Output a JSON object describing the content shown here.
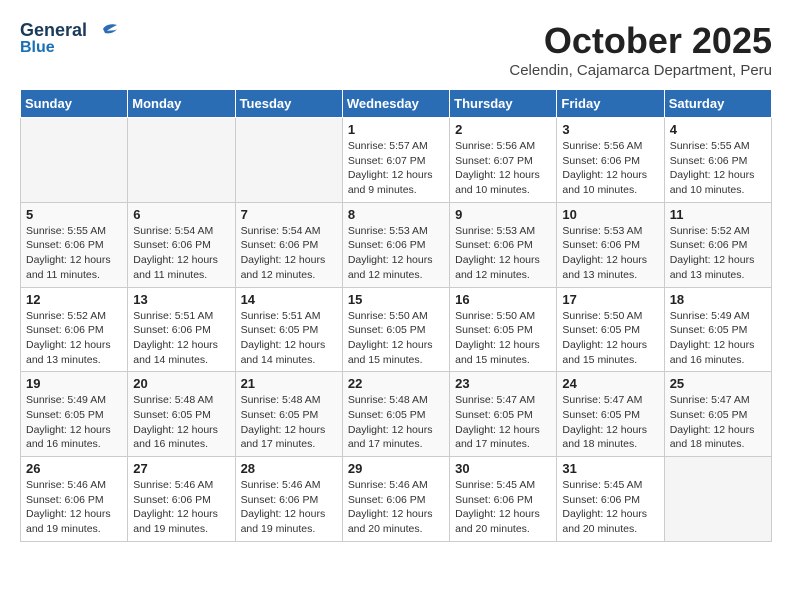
{
  "header": {
    "logo_general": "General",
    "logo_blue": "Blue",
    "month": "October 2025",
    "location": "Celendin, Cajamarca Department, Peru"
  },
  "days_of_week": [
    "Sunday",
    "Monday",
    "Tuesday",
    "Wednesday",
    "Thursday",
    "Friday",
    "Saturday"
  ],
  "weeks": [
    [
      {
        "day": "",
        "empty": true
      },
      {
        "day": "",
        "empty": true
      },
      {
        "day": "",
        "empty": true
      },
      {
        "day": "1",
        "sunrise": "5:57 AM",
        "sunset": "6:07 PM",
        "daylight": "12 hours and 9 minutes."
      },
      {
        "day": "2",
        "sunrise": "5:56 AM",
        "sunset": "6:07 PM",
        "daylight": "12 hours and 10 minutes."
      },
      {
        "day": "3",
        "sunrise": "5:56 AM",
        "sunset": "6:06 PM",
        "daylight": "12 hours and 10 minutes."
      },
      {
        "day": "4",
        "sunrise": "5:55 AM",
        "sunset": "6:06 PM",
        "daylight": "12 hours and 10 minutes."
      }
    ],
    [
      {
        "day": "5",
        "sunrise": "5:55 AM",
        "sunset": "6:06 PM",
        "daylight": "12 hours and 11 minutes."
      },
      {
        "day": "6",
        "sunrise": "5:54 AM",
        "sunset": "6:06 PM",
        "daylight": "12 hours and 11 minutes."
      },
      {
        "day": "7",
        "sunrise": "5:54 AM",
        "sunset": "6:06 PM",
        "daylight": "12 hours and 12 minutes."
      },
      {
        "day": "8",
        "sunrise": "5:53 AM",
        "sunset": "6:06 PM",
        "daylight": "12 hours and 12 minutes."
      },
      {
        "day": "9",
        "sunrise": "5:53 AM",
        "sunset": "6:06 PM",
        "daylight": "12 hours and 12 minutes."
      },
      {
        "day": "10",
        "sunrise": "5:53 AM",
        "sunset": "6:06 PM",
        "daylight": "12 hours and 13 minutes."
      },
      {
        "day": "11",
        "sunrise": "5:52 AM",
        "sunset": "6:06 PM",
        "daylight": "12 hours and 13 minutes."
      }
    ],
    [
      {
        "day": "12",
        "sunrise": "5:52 AM",
        "sunset": "6:06 PM",
        "daylight": "12 hours and 13 minutes."
      },
      {
        "day": "13",
        "sunrise": "5:51 AM",
        "sunset": "6:06 PM",
        "daylight": "12 hours and 14 minutes."
      },
      {
        "day": "14",
        "sunrise": "5:51 AM",
        "sunset": "6:05 PM",
        "daylight": "12 hours and 14 minutes."
      },
      {
        "day": "15",
        "sunrise": "5:50 AM",
        "sunset": "6:05 PM",
        "daylight": "12 hours and 15 minutes."
      },
      {
        "day": "16",
        "sunrise": "5:50 AM",
        "sunset": "6:05 PM",
        "daylight": "12 hours and 15 minutes."
      },
      {
        "day": "17",
        "sunrise": "5:50 AM",
        "sunset": "6:05 PM",
        "daylight": "12 hours and 15 minutes."
      },
      {
        "day": "18",
        "sunrise": "5:49 AM",
        "sunset": "6:05 PM",
        "daylight": "12 hours and 16 minutes."
      }
    ],
    [
      {
        "day": "19",
        "sunrise": "5:49 AM",
        "sunset": "6:05 PM",
        "daylight": "12 hours and 16 minutes."
      },
      {
        "day": "20",
        "sunrise": "5:48 AM",
        "sunset": "6:05 PM",
        "daylight": "12 hours and 16 minutes."
      },
      {
        "day": "21",
        "sunrise": "5:48 AM",
        "sunset": "6:05 PM",
        "daylight": "12 hours and 17 minutes."
      },
      {
        "day": "22",
        "sunrise": "5:48 AM",
        "sunset": "6:05 PM",
        "daylight": "12 hours and 17 minutes."
      },
      {
        "day": "23",
        "sunrise": "5:47 AM",
        "sunset": "6:05 PM",
        "daylight": "12 hours and 17 minutes."
      },
      {
        "day": "24",
        "sunrise": "5:47 AM",
        "sunset": "6:05 PM",
        "daylight": "12 hours and 18 minutes."
      },
      {
        "day": "25",
        "sunrise": "5:47 AM",
        "sunset": "6:05 PM",
        "daylight": "12 hours and 18 minutes."
      }
    ],
    [
      {
        "day": "26",
        "sunrise": "5:46 AM",
        "sunset": "6:06 PM",
        "daylight": "12 hours and 19 minutes."
      },
      {
        "day": "27",
        "sunrise": "5:46 AM",
        "sunset": "6:06 PM",
        "daylight": "12 hours and 19 minutes."
      },
      {
        "day": "28",
        "sunrise": "5:46 AM",
        "sunset": "6:06 PM",
        "daylight": "12 hours and 19 minutes."
      },
      {
        "day": "29",
        "sunrise": "5:46 AM",
        "sunset": "6:06 PM",
        "daylight": "12 hours and 20 minutes."
      },
      {
        "day": "30",
        "sunrise": "5:45 AM",
        "sunset": "6:06 PM",
        "daylight": "12 hours and 20 minutes."
      },
      {
        "day": "31",
        "sunrise": "5:45 AM",
        "sunset": "6:06 PM",
        "daylight": "12 hours and 20 minutes."
      },
      {
        "day": "",
        "empty": true
      }
    ]
  ]
}
